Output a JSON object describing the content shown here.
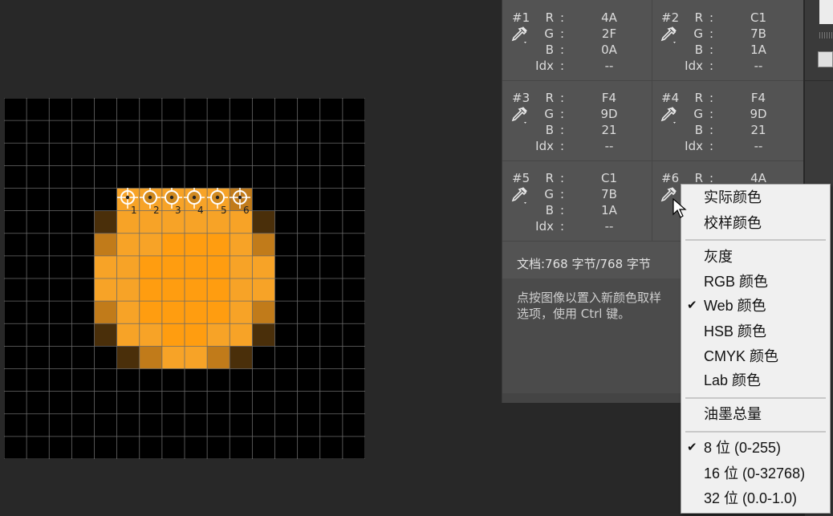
{
  "samples": [
    {
      "num": "#1",
      "channels": [
        {
          "label": "R",
          "value": "4A"
        },
        {
          "label": "G",
          "value": "2F"
        },
        {
          "label": "B",
          "value": "0A"
        },
        {
          "label": "Idx",
          "value": "--"
        }
      ]
    },
    {
      "num": "#2",
      "channels": [
        {
          "label": "R",
          "value": "C1"
        },
        {
          "label": "G",
          "value": "7B"
        },
        {
          "label": "B",
          "value": "1A"
        },
        {
          "label": "Idx",
          "value": "--"
        }
      ]
    },
    {
      "num": "#3",
      "channels": [
        {
          "label": "R",
          "value": "F4"
        },
        {
          "label": "G",
          "value": "9D"
        },
        {
          "label": "B",
          "value": "21"
        },
        {
          "label": "Idx",
          "value": "--"
        }
      ]
    },
    {
      "num": "#4",
      "channels": [
        {
          "label": "R",
          "value": "F4"
        },
        {
          "label": "G",
          "value": "9D"
        },
        {
          "label": "B",
          "value": "21"
        },
        {
          "label": "Idx",
          "value": "--"
        }
      ]
    },
    {
      "num": "#5",
      "channels": [
        {
          "label": "R",
          "value": "C1"
        },
        {
          "label": "G",
          "value": "7B"
        },
        {
          "label": "B",
          "value": "1A"
        },
        {
          "label": "Idx",
          "value": "--"
        }
      ]
    },
    {
      "num": "#6",
      "channels": [
        {
          "label": "R",
          "value": "4A"
        }
      ]
    }
  ],
  "colon": ":",
  "doc_size": "文档:768 字节/768 字节",
  "hint": "点按图像以置入新颜色取样\n选项，使用 Ctrl 键。",
  "canvas": {
    "marker_labels": [
      "1",
      "2",
      "3",
      "4",
      "5",
      "6"
    ]
  },
  "menu": {
    "items": [
      "实际颜色",
      "校样颜色",
      "灰度",
      "RGB 颜色",
      "Web 颜色",
      "HSB 颜色",
      "CMYK 颜色",
      "Lab 颜色",
      "油墨总量",
      "8 位 (0-255)",
      "16 位 (0-32768)",
      "32 位 (0.0-1.0)"
    ],
    "checked": [
      "Web 颜色",
      "8 位 (0-255)"
    ],
    "check_glyph": "✔"
  },
  "colors": {
    "sample_1": "#4A2F0A",
    "sample_2": "#C17B1A",
    "sample_3": "#F49D21",
    "sample_4": "#F49D21",
    "sample_5": "#C17B1A",
    "sample_6": "#4A2F0A"
  }
}
